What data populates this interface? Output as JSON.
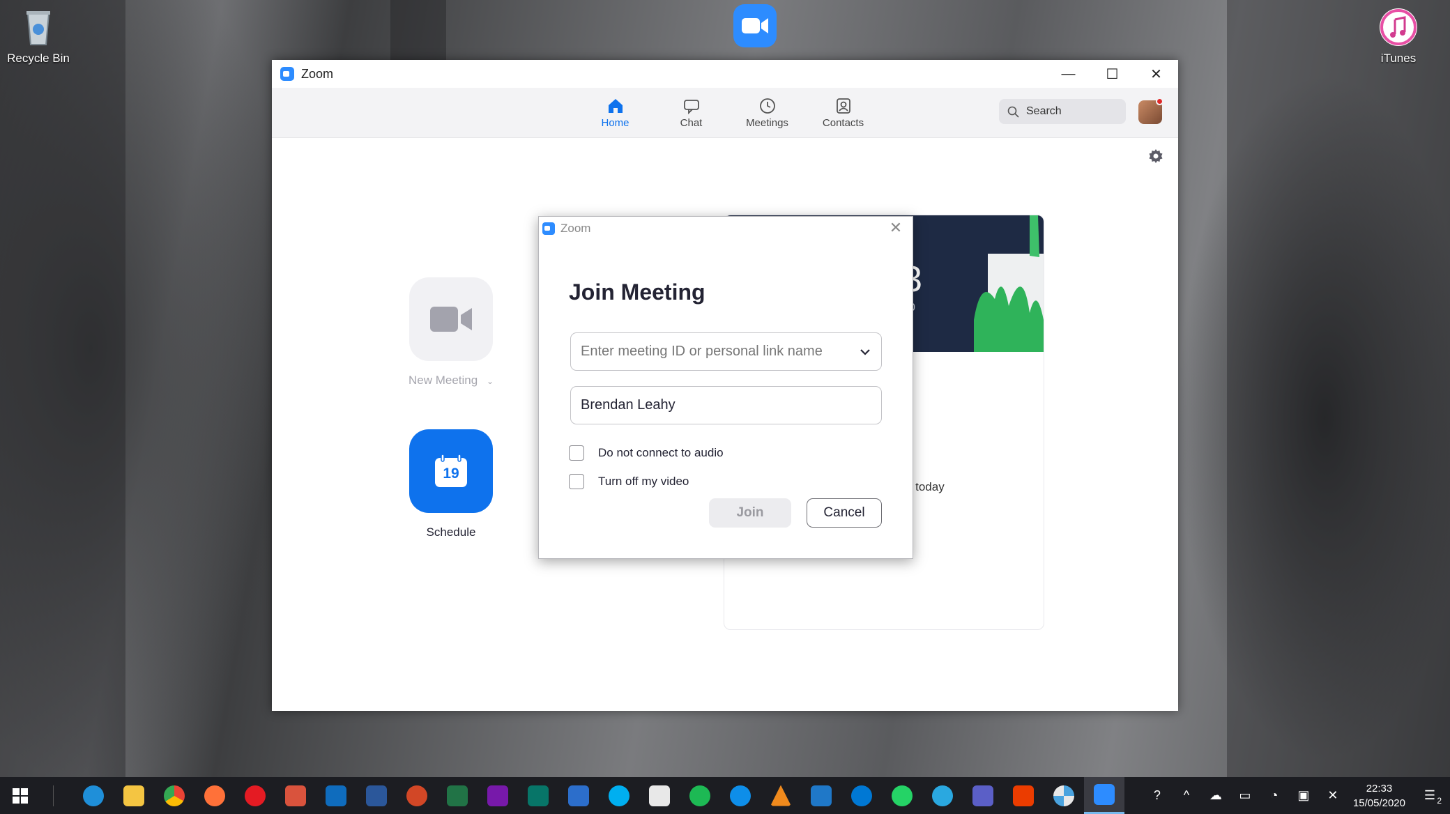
{
  "desktop": {
    "icons": [
      {
        "label": "Recycle Bin"
      },
      {
        "label": "iTunes"
      }
    ]
  },
  "window": {
    "title": "Zoom",
    "controls": {
      "minimize": "—",
      "maximize": "☐",
      "close": "✕"
    }
  },
  "nav": {
    "tabs": [
      {
        "label": "Home",
        "icon": "home-icon",
        "active": true
      },
      {
        "label": "Chat",
        "icon": "chat-icon",
        "active": false
      },
      {
        "label": "Meetings",
        "icon": "clock-icon",
        "active": false
      },
      {
        "label": "Contacts",
        "icon": "contacts-icon",
        "active": false
      }
    ],
    "search_label": "Search"
  },
  "home": {
    "new_meeting_label": "New Meeting",
    "schedule_label": "Schedule",
    "schedule_day": "19"
  },
  "card": {
    "clock_partial": "3",
    "date_partial": "0",
    "no_meetings_partial": "ngs today"
  },
  "dialog": {
    "title": "Zoom",
    "heading": "Join Meeting",
    "meeting_id_placeholder": "Enter meeting ID or personal link name",
    "name_value": "Brendan Leahy",
    "options": [
      {
        "label": "Do not connect to audio",
        "checked": false
      },
      {
        "label": "Turn off my video",
        "checked": false
      }
    ],
    "join_label": "Join",
    "cancel_label": "Cancel",
    "close_glyph": "✕"
  },
  "taskbar": {
    "time": "22:33",
    "date": "15/05/2020",
    "notification_count": "2"
  },
  "colors": {
    "accent": "#0e72ed",
    "zoom_blue": "#2d8cff",
    "schedule_tile": "#0e72ed",
    "taskbar": "#1c1d22"
  }
}
